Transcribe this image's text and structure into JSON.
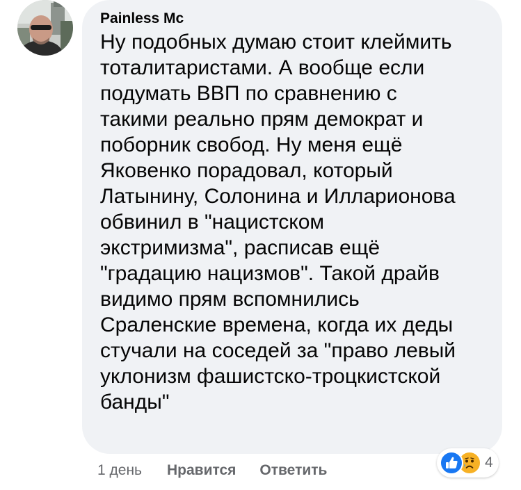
{
  "comment": {
    "author": "Painless Mc",
    "lines": [
      "Ну подобных думаю стоит клеймить",
      "тоталитаристами. А вообще если",
      "подумать ВВП по сравнению с",
      "такими реально прям демократ и",
      "поборник свобод. Ну меня ещё",
      "Яковенко порадовал, который",
      "Латынину, Солонина и Илларионова",
      "обвинил в \"нацистском",
      "экстримизма\", расписав ещё",
      "\"градацию нацизмов\". Такой драйв",
      "видимо прям вспомнились",
      "Сраленские времена, когда их деды",
      "стучали на соседей за \"право левый",
      "уклонизм фашистско-троцкистской",
      "банды\""
    ]
  },
  "actions": {
    "time": "1 день",
    "like_label": "Нравится",
    "reply_label": "Ответить"
  },
  "reactions": {
    "icons": [
      "like-icon",
      "sad-icon"
    ],
    "count": "4",
    "like_color": "#1877f2",
    "sad_color": "#f7b125"
  },
  "colors": {
    "bubble": "#f0f2f5",
    "text": "#050505",
    "muted": "#65676b"
  }
}
